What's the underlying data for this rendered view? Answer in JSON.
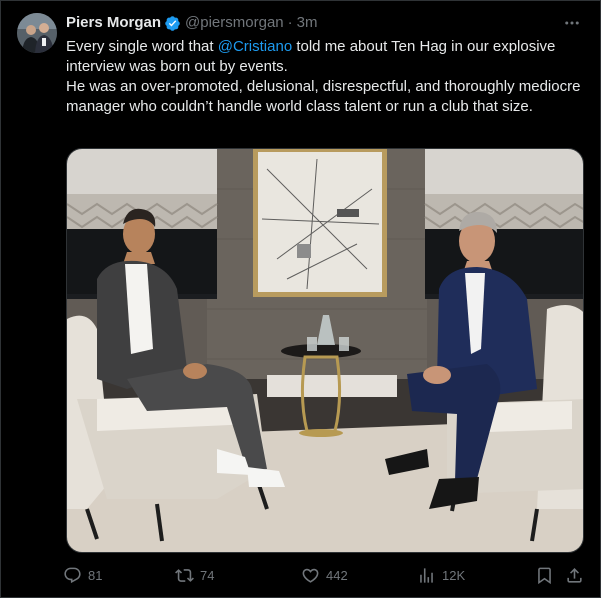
{
  "author": {
    "name": "Piers Morgan",
    "handle": "@piersmorgan",
    "separator": "·",
    "time": "3m",
    "verified_color": "#1d9bf0"
  },
  "tweet": {
    "line1_pre": "Every single word that ",
    "mention": "@Cristiano",
    "line1_post": " told me about Ten Hag in our explosive interview was born out by events.",
    "line2": "He was an over-promoted, delusional, disrespectful, and thoroughly mediocre manager who couldn’t handle world class talent or run a club that size."
  },
  "media": {
    "alt": "Cristiano Ronaldo and Piers Morgan seated in armchairs facing each other during an interview"
  },
  "actions": {
    "replies": "81",
    "retweets": "74",
    "likes": "442",
    "views": "12K",
    "reply_icon": "reply-icon",
    "retweet_icon": "retweet-icon",
    "like_icon": "heart-icon",
    "views_icon": "views-icon",
    "bookmark_icon": "bookmark-icon",
    "share_icon": "share-icon"
  },
  "colors": {
    "background": "#000000",
    "text": "#e7e9ea",
    "muted": "#71767b",
    "accent": "#1d9bf0"
  }
}
